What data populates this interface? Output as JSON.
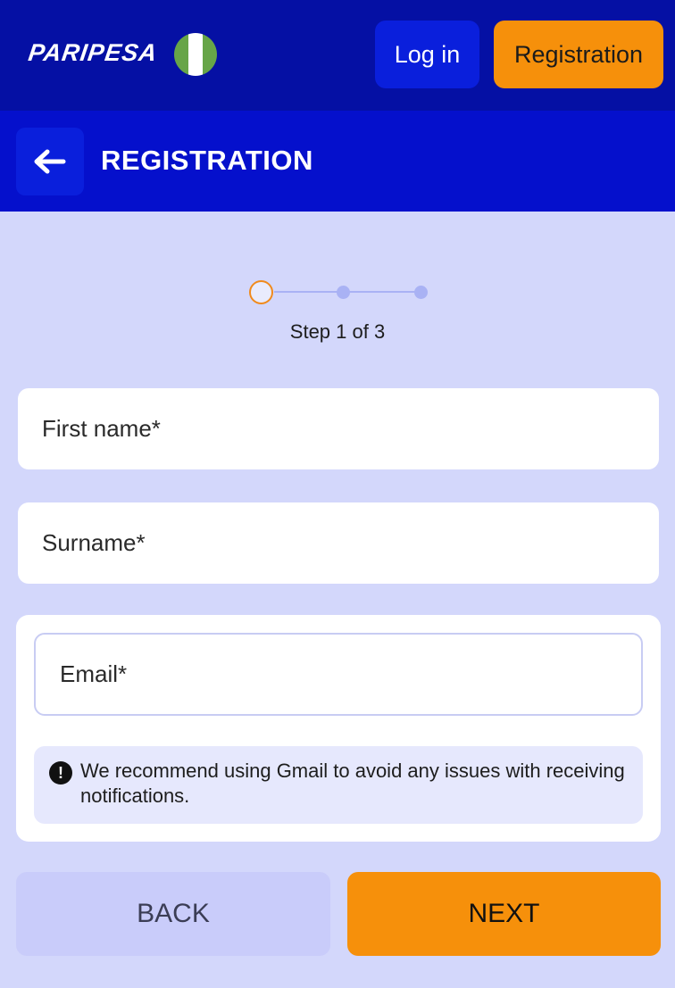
{
  "header": {
    "logo_text": "PARIPESA",
    "flag_icon": "nigeria-flag-icon",
    "login_label": "Log in",
    "registration_label": "Registration"
  },
  "titlebar": {
    "back_icon": "arrow-left-icon",
    "title": "REGISTRATION"
  },
  "stepper": {
    "current_step": 1,
    "total_steps": 3,
    "label": "Step 1 of 3"
  },
  "form": {
    "first_name_placeholder": "First name*",
    "surname_placeholder": "Surname*",
    "email_placeholder": "Email*",
    "notice_icon": "exclamation-circle-icon",
    "notice_text": "We recommend using Gmail to avoid any issues with receiving notifications."
  },
  "actions": {
    "back_label": "BACK",
    "next_label": "NEXT"
  },
  "colors": {
    "header_bg": "#0510a4",
    "titlebar_bg": "#0510cc",
    "page_bg": "#d3d7fb",
    "accent_orange": "#f6900b",
    "login_button": "#0a1fdc"
  }
}
